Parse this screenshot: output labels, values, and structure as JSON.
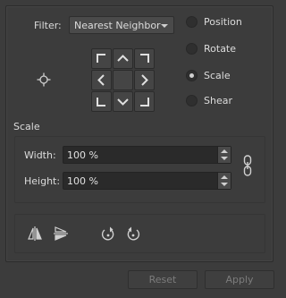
{
  "filter": {
    "label": "Filter:",
    "selected": "Nearest Neighbor"
  },
  "modes": [
    {
      "label": "Position",
      "selected": false
    },
    {
      "label": "Rotate",
      "selected": false
    },
    {
      "label": "Scale",
      "selected": true
    },
    {
      "label": "Shear",
      "selected": false
    }
  ],
  "scale": {
    "title": "Scale",
    "width_label": "Width:",
    "width_value": "100 %",
    "height_label": "Height:",
    "height_value": "100 %"
  },
  "buttons": {
    "reset": "Reset",
    "apply": "Apply"
  },
  "icons": {
    "pivot": "crosshair-icon",
    "chain": "chain-link-icon",
    "flip_h": "flip-horizontal-icon",
    "flip_v": "flip-vertical-icon",
    "rotate_ccw": "rotate-ccw-icon",
    "rotate_cw": "rotate-cw-icon"
  }
}
